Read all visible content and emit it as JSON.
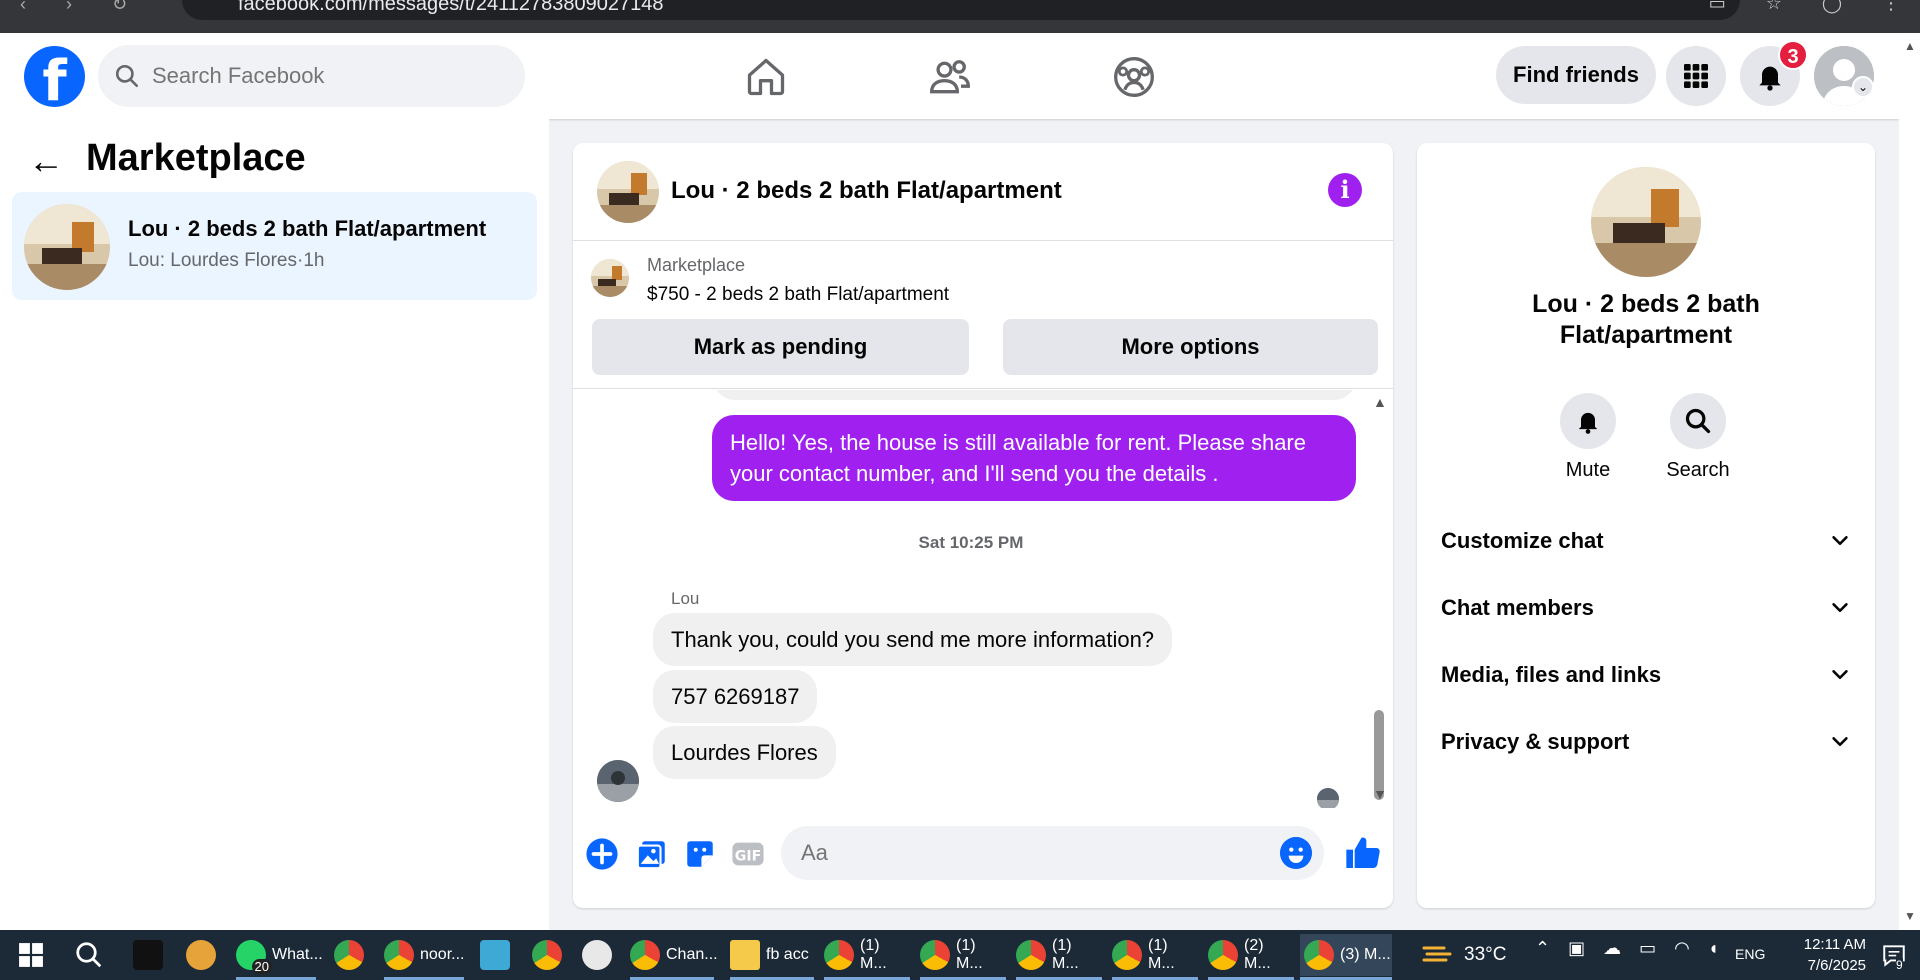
{
  "browser": {
    "url": "facebook.com/messages/t/24112783809027148"
  },
  "header": {
    "search_placeholder": "Search Facebook",
    "find_friends": "Find friends",
    "notification_count": "3",
    "nav_icons": [
      "home-icon",
      "friends-icon",
      "groups-icon"
    ],
    "brand_color": "#0866ff"
  },
  "sidebar": {
    "title": "Marketplace",
    "conversation": {
      "name": "Lou · 2 beds 2 bath Flat/apartment",
      "preview": "Lou: Lourdes Flores",
      "time": "1h",
      "separator": "·"
    }
  },
  "chat": {
    "title": "Lou · 2 beds 2 bath Flat/apartment",
    "listing": {
      "label": "Marketplace",
      "price_title": "$750 - 2 beds 2 bath Flat/apartment"
    },
    "buttons": {
      "pending": "Mark as pending",
      "options": "More options"
    },
    "outgoing_message": "Hello! Yes, the house is still available for rent. Please share your contact number, and I'll send you the details .",
    "timestamp": "Sat 10:25 PM",
    "sender_name": "Lou",
    "incoming_messages": [
      "Thank you, could you send me more information?",
      "757 6269187",
      "Lourdes Flores"
    ],
    "composer_placeholder": "Aa",
    "accent_color": "#a020f0"
  },
  "right_panel": {
    "title": "Lou · 2 beds 2 bath Flat/apartment",
    "actions": [
      "Mute",
      "Search"
    ],
    "sections": [
      "Customize chat",
      "Chat members",
      "Media, files and links",
      "Privacy & support"
    ]
  },
  "taskbar": {
    "items": [
      {
        "label": "What...",
        "badge": "20"
      },
      {
        "label": "noor..."
      },
      {
        "label": "Chan..."
      },
      {
        "label": "fb acc"
      },
      {
        "label": "(1) M..."
      },
      {
        "label": "(1) M..."
      },
      {
        "label": "(1) M..."
      },
      {
        "label": "(1) M..."
      },
      {
        "label": "(2) M..."
      },
      {
        "label": "(3) M..."
      }
    ],
    "temperature": "33°C",
    "language": "ENG",
    "time": "12:11 AM",
    "date": "7/6/2025",
    "notification_count": "9"
  }
}
